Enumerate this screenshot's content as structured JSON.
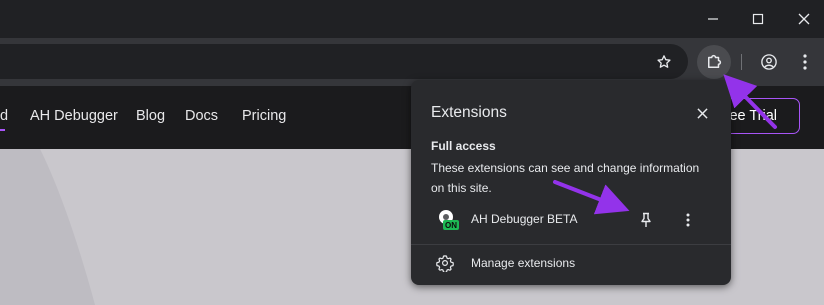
{
  "browser": {
    "window_controls": [
      "minimize-icon",
      "maximize-icon",
      "close-icon"
    ],
    "toolbar_icons": [
      "star-icon",
      "puzzle-extensions-icon",
      "profile-icon",
      "kebab-menu-icon"
    ]
  },
  "site": {
    "nav": {
      "cut_item": "d",
      "items": [
        "AH Debugger",
        "Blog",
        "Docs",
        "Pricing"
      ],
      "cta_label": "ree Trial"
    }
  },
  "extensions_popup": {
    "title": "Extensions",
    "section_title": "Full access",
    "section_desc": "These extensions can see and change information on this site.",
    "extension": {
      "name": "AH Debugger BETA",
      "badge": "ON"
    },
    "manage_label": "Manage extensions"
  },
  "colors": {
    "accent": "#a855f7",
    "badge": "#1db954",
    "popup_bg": "#292a2d"
  }
}
